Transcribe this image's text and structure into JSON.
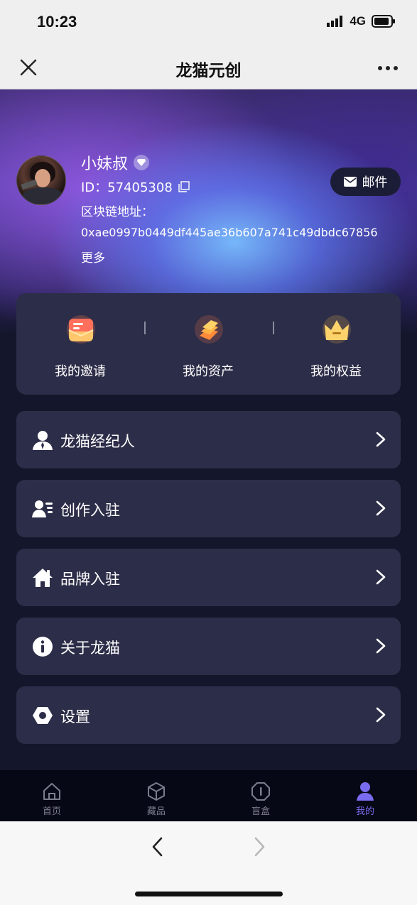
{
  "status": {
    "time": "10:23",
    "network": "4G"
  },
  "nav": {
    "title": "龙猫元创"
  },
  "profile": {
    "name": "小妹叔",
    "id_text": "ID：57405308",
    "chain_label": "区块链地址：",
    "chain_address": "0xae0997b0449df445ae36b607a741c49dbdc67856",
    "more": "更多",
    "mail_label": "邮件"
  },
  "quick": [
    {
      "label": "我的邀请",
      "icon": "invite-envelope-icon"
    },
    {
      "label": "我的资产",
      "icon": "gold-bars-icon"
    },
    {
      "label": "我的权益",
      "icon": "crown-icon"
    }
  ],
  "menu": [
    {
      "label": "龙猫经纪人",
      "icon": "agent-person-icon"
    },
    {
      "label": "创作入驻",
      "icon": "creator-list-icon"
    },
    {
      "label": "品牌入驻",
      "icon": "house-icon"
    },
    {
      "label": "关于龙猫",
      "icon": "info-icon"
    },
    {
      "label": "设置",
      "icon": "settings-hexagon-icon"
    }
  ],
  "tabs": [
    {
      "label": "首页",
      "icon": "home-icon"
    },
    {
      "label": "藏品",
      "icon": "box-icon"
    },
    {
      "label": "盲盒",
      "icon": "blind-box-icon"
    },
    {
      "label": "我的",
      "icon": "user-icon",
      "active": true
    }
  ],
  "colors": {
    "accent": "#7a6cf0",
    "card": "#2c2d48",
    "background": "#14162b"
  }
}
